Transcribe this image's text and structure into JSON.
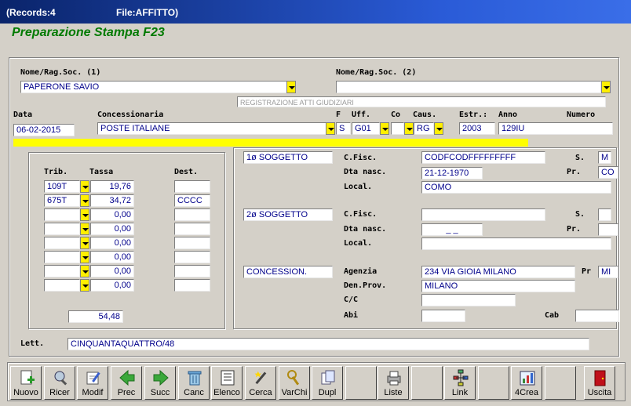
{
  "window": {
    "records": "(Records:4",
    "file": "File:AFFITTO)"
  },
  "heading": "Preparazione Stampa F23",
  "top": {
    "nome1_label": "Nome/Rag.Soc. (1)",
    "nome1_value": "PAPERONE SAVIO",
    "nome2_label": "Nome/Rag.Soc. (2)",
    "nome2_value": "",
    "registrazione": "REGISTRAZIONE ATTI GIUDIZIARI",
    "data_label": "Data",
    "data_value": "06-02-2015",
    "concessionaria_label": "Concessionaria",
    "concessionaria_value": "POSTE ITALIANE",
    "f_label": "F",
    "f_value": "S",
    "uff_label": "Uff.",
    "uff_value": "G01",
    "co_label": "Co",
    "co_value": "",
    "caus_label": "Caus.",
    "caus_value": "RG",
    "estr_label": "Estr.:",
    "estr_value": "2003",
    "anno_label": "Anno",
    "anno_value": "129IU",
    "numero_label": "Numero"
  },
  "tributi": {
    "trib_label": "Trib.",
    "tassa_label": "Tassa",
    "dest_label": "Dest.",
    "rows": [
      {
        "trib": "109T",
        "tassa": "19,76",
        "dest": ""
      },
      {
        "trib": "675T",
        "tassa": "34,72",
        "dest": "CCCC"
      },
      {
        "trib": "",
        "tassa": "0,00",
        "dest": ""
      },
      {
        "trib": "",
        "tassa": "0,00",
        "dest": ""
      },
      {
        "trib": "",
        "tassa": "0,00",
        "dest": ""
      },
      {
        "trib": "",
        "tassa": "0,00",
        "dest": ""
      },
      {
        "trib": "",
        "tassa": "0,00",
        "dest": ""
      },
      {
        "trib": "",
        "tassa": "0,00",
        "dest": ""
      }
    ],
    "totale": "54,48"
  },
  "soggetto1": {
    "title": "1ø SOGGETTO",
    "cfisc_label": "C.Fisc.",
    "cfisc_value": "CODFCODFFFFFFFFF",
    "s_label": "S.",
    "s_value": "M",
    "dtanasc_label": "Dta nasc.",
    "dtanasc_value": "21-12-1970",
    "pr_label": "Pr.",
    "pr_value": "CO",
    "local_label": "Local.",
    "local_value": "COMO"
  },
  "soggetto2": {
    "title": "2ø SOGGETTO",
    "cfisc_label": "C.Fisc.",
    "cfisc_value": "",
    "s_label": "S.",
    "s_value": "",
    "dtanasc_label": "Dta nasc.",
    "dtanasc_value": "_ _",
    "pr_label": "Pr.",
    "pr_value": "",
    "local_label": "Local.",
    "local_value": ""
  },
  "concessione": {
    "title": "CONCESSION.",
    "agenzia_label": "Agenzia",
    "agenzia_value": "234 VIA GIOIA MILANO",
    "pr_label": "Pr",
    "pr_value": "MI",
    "denprov_label": "Den.Prov.",
    "denprov_value": "MILANO",
    "cc_label": "C/C",
    "cc_value": "",
    "abi_label": "Abi",
    "abi_value": "",
    "cab_label": "Cab",
    "cab_value": ""
  },
  "lettere": {
    "label": "Lett.",
    "value": "CINQUANTAQUATTRO/48"
  },
  "toolbar": [
    {
      "label": "Nuovo",
      "icon": "new-document-icon"
    },
    {
      "label": "Ricer",
      "icon": "search-icon"
    },
    {
      "label": "Modif",
      "icon": "edit-icon"
    },
    {
      "label": "Prec",
      "icon": "arrow-left-icon"
    },
    {
      "label": "Succ",
      "icon": "arrow-right-icon"
    },
    {
      "label": "Canc",
      "icon": "trash-icon"
    },
    {
      "label": "Elenco",
      "icon": "list-icon"
    },
    {
      "label": "Cerca",
      "icon": "magic-wand-icon"
    },
    {
      "label": "VarChi",
      "icon": "keys-icon"
    },
    {
      "label": "Dupl",
      "icon": "duplicate-icon"
    },
    {
      "label": "",
      "icon": ""
    },
    {
      "label": "Liste",
      "icon": "printer-icon"
    },
    {
      "label": "",
      "icon": ""
    },
    {
      "label": "Link",
      "icon": "network-icon"
    },
    {
      "label": "",
      "icon": ""
    },
    {
      "label": "4Crea",
      "icon": "chart-icon"
    },
    {
      "label": "",
      "icon": ""
    },
    {
      "label": "Uscita",
      "icon": "exit-door-icon"
    }
  ]
}
